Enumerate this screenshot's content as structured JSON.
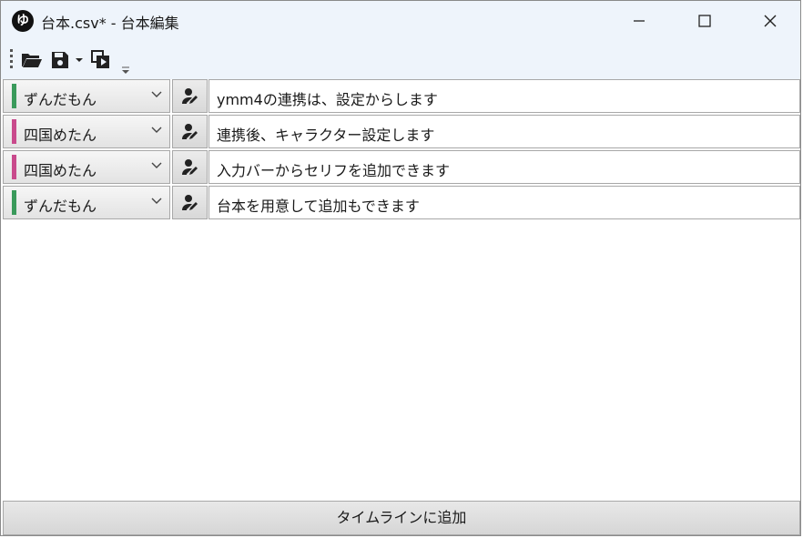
{
  "window": {
    "app_icon_glyph": "ゆ",
    "title": "台本.csv* - 台本編集"
  },
  "toolbar": {
    "icons": [
      "folder-open-icon",
      "save-icon",
      "dropdown-arrow-icon",
      "copy-play-icon",
      "overflow-icon"
    ]
  },
  "rows": [
    {
      "speaker": "ずんだもん",
      "color": "#3a9a5b",
      "text": "ymm4の連携は、設定からします"
    },
    {
      "speaker": "四国めたん",
      "color": "#c94a8c",
      "text": "連携後、キャラクター設定します"
    },
    {
      "speaker": "四国めたん",
      "color": "#c94a8c",
      "text": "入力バーからセリフを追加できます"
    },
    {
      "speaker": "ずんだもん",
      "color": "#3a9a5b",
      "text": "台本を用意して追加もできます"
    }
  ],
  "footer": {
    "add_to_timeline": "タイムラインに追加"
  }
}
